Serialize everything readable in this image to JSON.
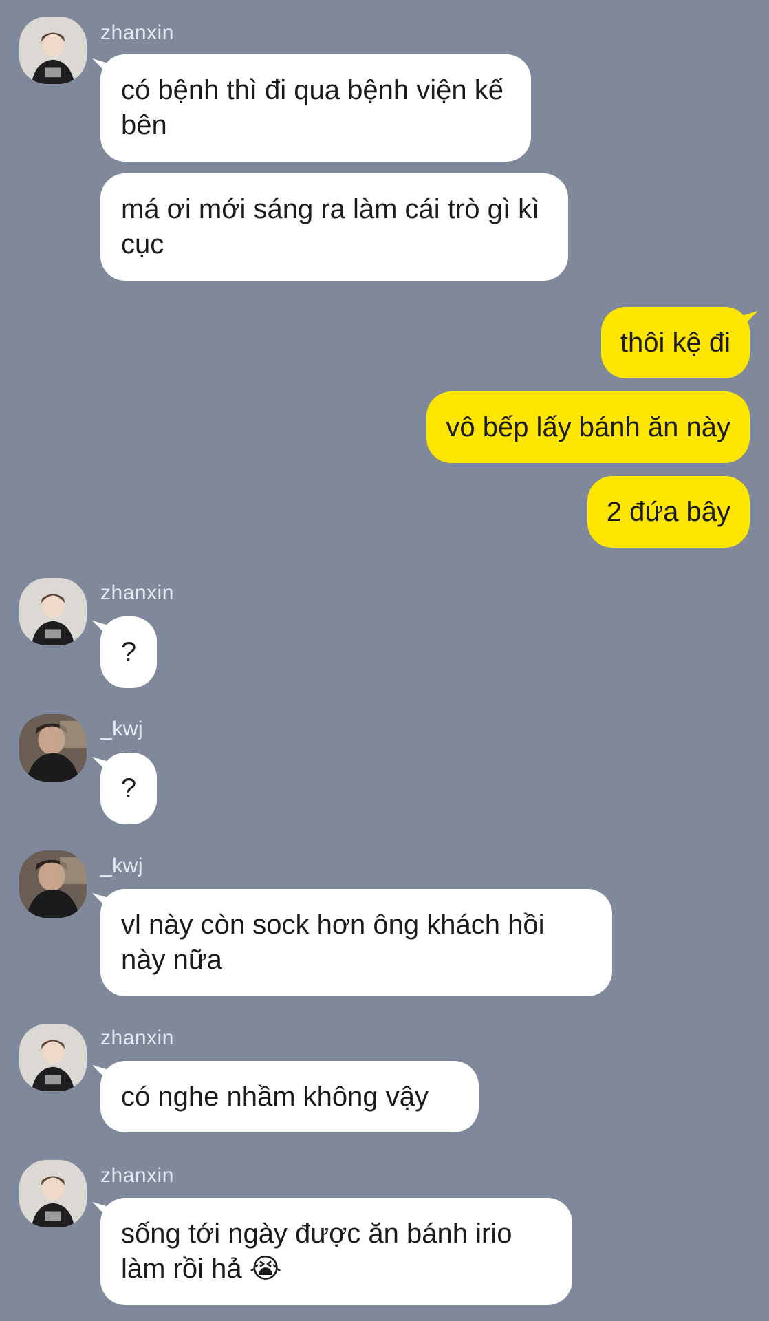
{
  "messages": [
    {
      "sender": "zhanxin",
      "lines": [
        "có bệnh thì đi qua bệnh viện kế bên",
        "má ơi mới sáng ra làm cái trò gì kì cục"
      ]
    },
    {
      "sender": "me",
      "lines": [
        "thôi kệ đi",
        "vô bếp lấy bánh ăn này",
        "2 đứa bây"
      ]
    },
    {
      "sender": "zhanxin",
      "lines": [
        "?"
      ]
    },
    {
      "sender": "_kwj",
      "lines": [
        "?"
      ]
    },
    {
      "sender": "_kwj",
      "lines": [
        "vl này còn sock hơn ông khách hồi này nữa"
      ]
    },
    {
      "sender": "zhanxin",
      "lines": [
        "có nghe nhầm không vậy"
      ]
    },
    {
      "sender": "zhanxin",
      "lines": [
        "sống tới ngày được ăn bánh irio làm rồi hả"
      ],
      "emoji": "😭"
    }
  ],
  "colors": {
    "background": "#7f899b",
    "incoming": "#ffffff",
    "outgoing": "#ffe600"
  },
  "icons": {
    "avatar_zhanxin": "avatar-photo",
    "avatar_kwj": "avatar-photo"
  }
}
